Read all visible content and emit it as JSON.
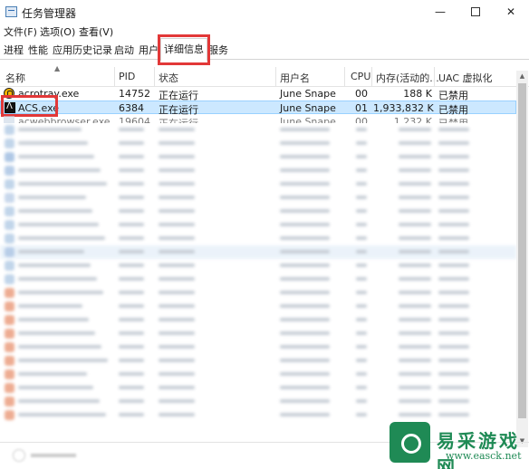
{
  "window": {
    "title": "任务管理器",
    "minimize_glyph": "—",
    "close_glyph": "✕"
  },
  "menu": [
    "文件(F)",
    "选项(O)",
    "查看(V)"
  ],
  "tabs": [
    "进程",
    "性能",
    "应用历史记录",
    "启动",
    "用户",
    "详细信息",
    "服务"
  ],
  "active_tab": "详细信息",
  "columns": {
    "name": "名称",
    "pid": "PID",
    "status": "状态",
    "user": "用户名",
    "cpu": "CPU",
    "memory": "内存(活动的...",
    "uac": "UAC 虚拟化"
  },
  "processes": [
    {
      "name": "acrotray.exe",
      "pid": "14752",
      "status": "正在运行",
      "user": "June Snape",
      "cpu": "00",
      "memory": "188 K",
      "uac": "已禁用",
      "icon": "acrotray-icon",
      "selected": false
    },
    {
      "name": "ACS.exe",
      "pid": "6384",
      "status": "正在运行",
      "user": "June Snape",
      "cpu": "01",
      "memory": "1,933,832 K",
      "uac": "已禁用",
      "icon": "acs-icon",
      "selected": true
    },
    {
      "name": "acwebbrowser.exe",
      "pid": "19604",
      "status": "正在运行",
      "user": "June Snape",
      "cpu": "00",
      "memory": "1,232 K",
      "uac": "已禁用",
      "icon": "generic-icon",
      "selected": false
    }
  ],
  "colors": {
    "highlight": "#e23838",
    "selected_row": "#cce8ff",
    "watermark": "#1f8a55"
  },
  "watermark": {
    "title": "易采游戏网",
    "url": "www.easck.net"
  }
}
